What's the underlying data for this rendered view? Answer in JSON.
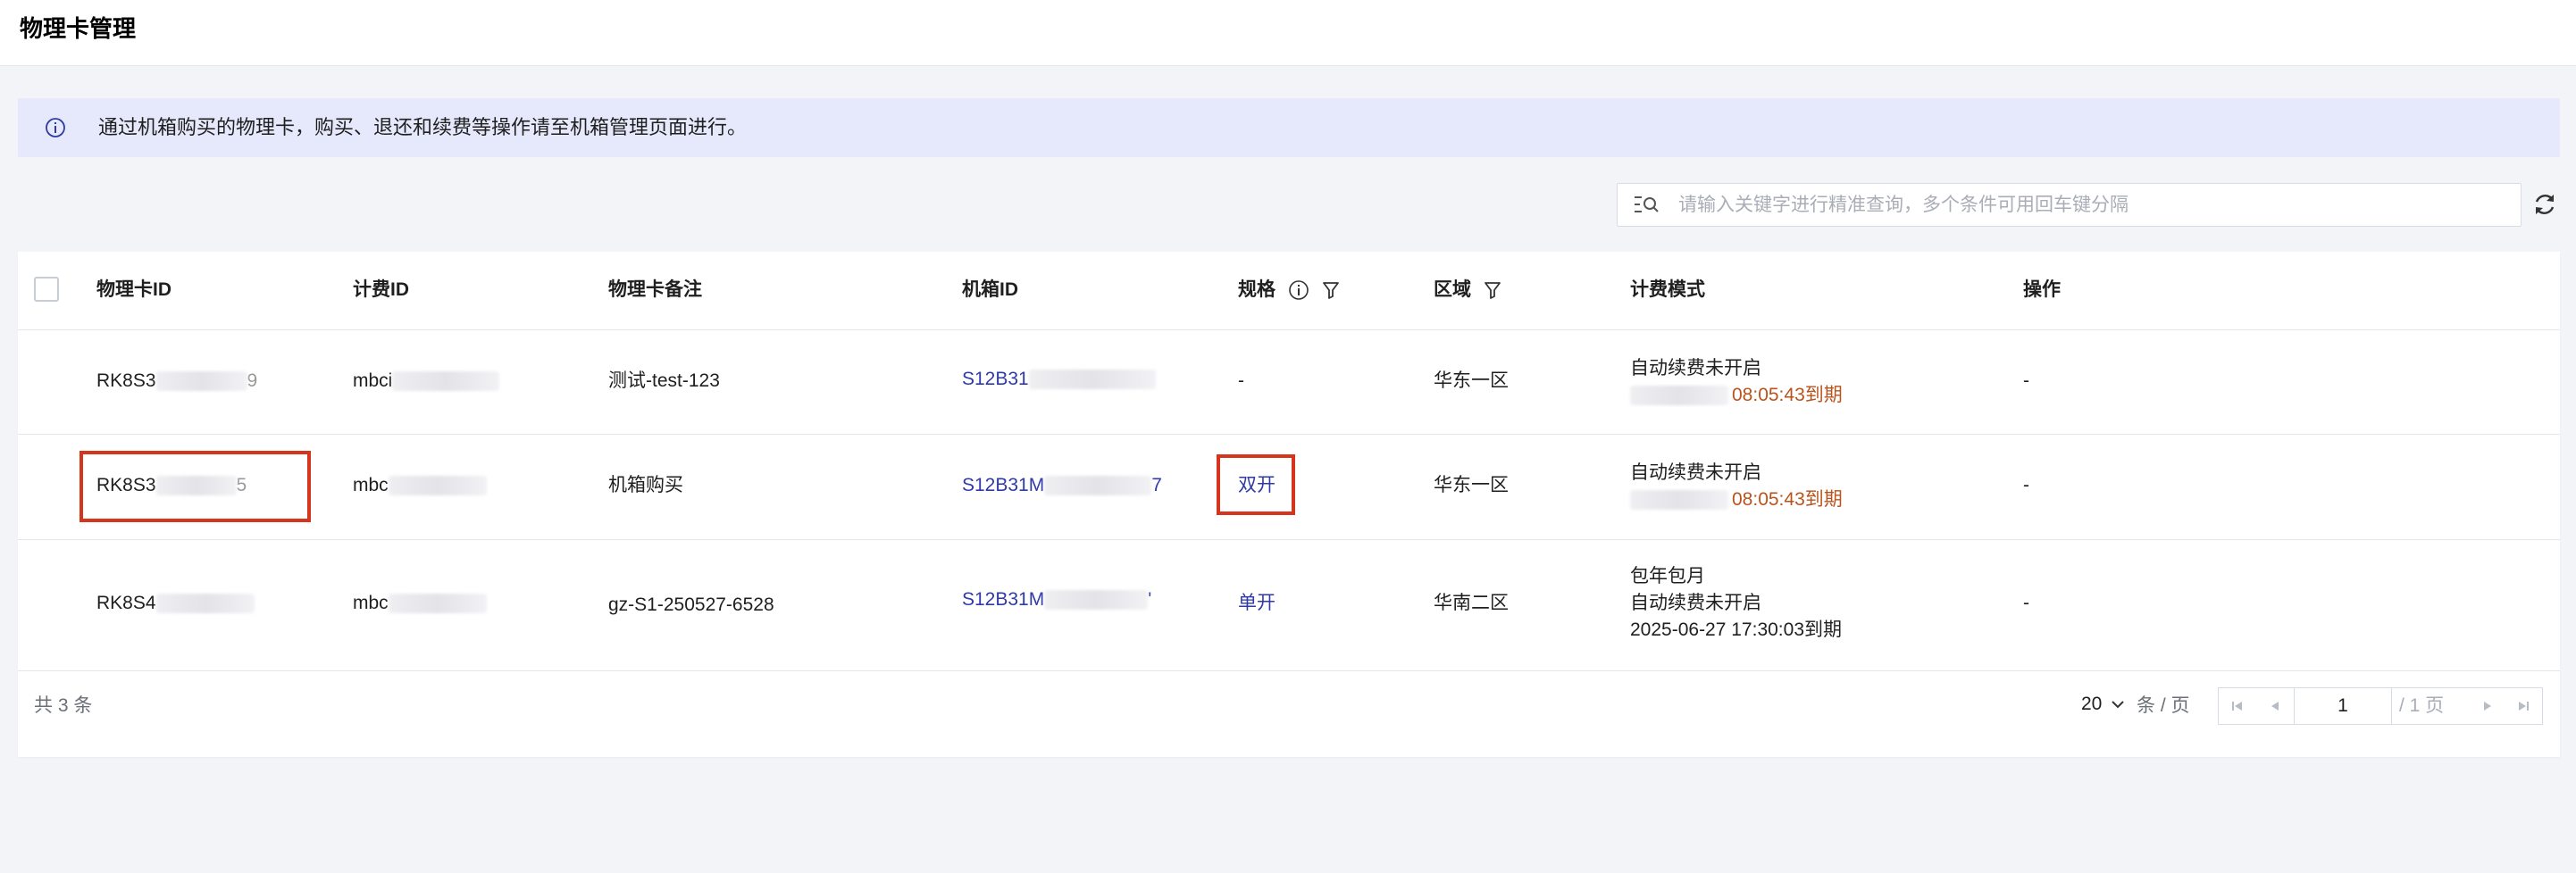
{
  "page": {
    "title": "物理卡管理"
  },
  "notice": {
    "text": "通过机箱购买的物理卡，购买、退还和续费等操作请至机箱管理页面进行。"
  },
  "search": {
    "placeholder": "请输入关键字进行精准查询，多个条件可用回车键分隔"
  },
  "table": {
    "headers": {
      "card_id": "物理卡ID",
      "billing_id": "计费ID",
      "remark": "物理卡备注",
      "chassis_id": "机箱ID",
      "spec": "规格",
      "region": "区域",
      "billing_mode": "计费模式",
      "action": "操作"
    },
    "rows": [
      {
        "card_id": "RK8S3",
        "card_id_tail": "9",
        "billing_id": "mbci",
        "remark": "测试-test-123",
        "chassis_id": "S12B31",
        "spec": "-",
        "region": "华东一区",
        "billing_line1": "自动续费未开启",
        "billing_line2": "08:05:43到期",
        "action": "-"
      },
      {
        "card_id": "RK8S3",
        "card_id_tail": "5",
        "billing_id": "mbc",
        "remark": "机箱购买",
        "chassis_id": "S12B31M",
        "chassis_tail": "7",
        "spec": "双开",
        "region": "华东一区",
        "billing_line1": "自动续费未开启",
        "billing_line2": "08:05:43到期",
        "action": "-"
      },
      {
        "card_id": "RK8S4",
        "billing_id": "mbc",
        "remark": "gz-S1-250527-6528",
        "chassis_id": "S12B31M",
        "chassis_tail": "'",
        "spec": "单开",
        "region": "华南二区",
        "billing_line0": "包年包月",
        "billing_line1": "自动续费未开启",
        "billing_line2": "2025-06-27 17:30:03到期",
        "action": "-"
      }
    ]
  },
  "footer": {
    "total": "共 3 条",
    "page_size": "20",
    "page_size_unit": "条 / 页",
    "current_page": "1",
    "total_pages": "/ 1 页"
  },
  "colors": {
    "link": "#2f3aa8",
    "expire_orange": "#b9531c",
    "highlight_red": "#d5351c",
    "notice_bg": "#e5e9fb"
  },
  "icons": [
    "info-icon",
    "search-filter-icon",
    "refresh-icon",
    "filter-icon",
    "chevron-down-icon",
    "first-page-icon",
    "prev-page-icon",
    "next-page-icon",
    "last-page-icon"
  ]
}
